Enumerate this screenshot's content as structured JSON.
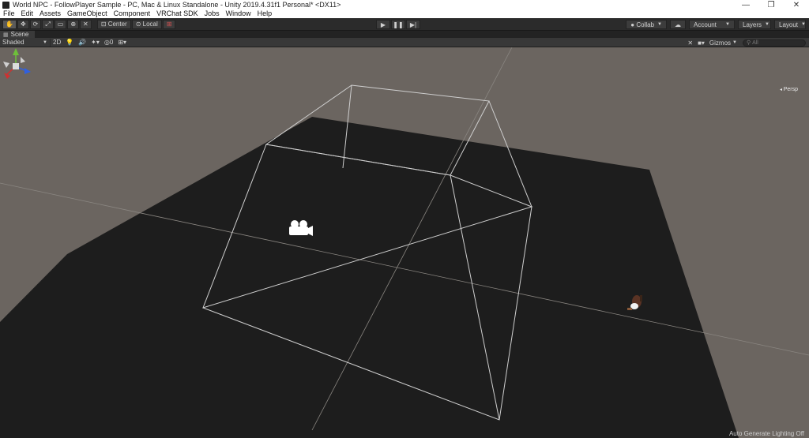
{
  "window": {
    "title": "World NPC - FollowPlayer Sample - PC, Mac & Linux Standalone - Unity 2019.4.31f1 Personal* <DX11>",
    "controls": [
      "—",
      "❐",
      "✕"
    ]
  },
  "menu": {
    "items": [
      "File",
      "Edit",
      "Assets",
      "GameObject",
      "Component",
      "VRChat SDK",
      "Jobs",
      "Window",
      "Help"
    ]
  },
  "toolbar": {
    "pivot_label": "Center",
    "rotation_label": "Local",
    "collab_label": "Collab",
    "account_label": "Account",
    "layers_label": "Layers",
    "layout_label": "Layout"
  },
  "scene_tab": {
    "label": "Scene"
  },
  "scene_toolbar": {
    "shading_mode": "Shaded",
    "mode_2d": "2D",
    "hidden_count": "0",
    "gizmos_label": "Gizmos",
    "search_placeholder": "All"
  },
  "viewport": {
    "projection_label": "Persp",
    "lighting_status": "Auto Generate Lighting Off"
  },
  "colors": {
    "background": "#6b6560",
    "ground": "#1d1d1d",
    "frustum": "#cfcfcf",
    "axis_x": "#d03030",
    "axis_y": "#6ec03a",
    "axis_z": "#3060e0"
  }
}
